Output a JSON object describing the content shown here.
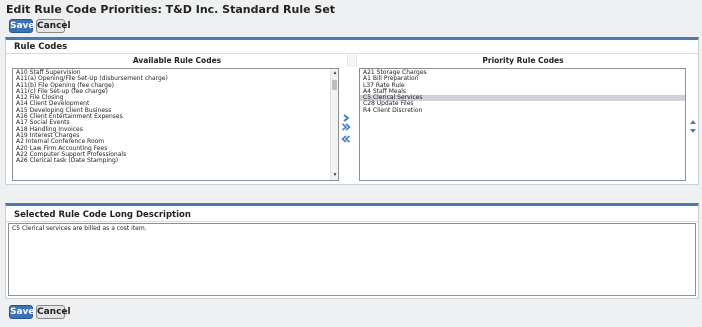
{
  "page_title": "Edit Rule Code Priorities: T&D Inc. Standard Rule Set",
  "top_toolbar": {
    "save_label": "Save",
    "cancel_label": "Cancel"
  },
  "rule_codes": {
    "section_title": "Rule Codes",
    "available_header": "Available Rule Codes",
    "priority_header": "Priority Rule Codes",
    "available_items": [
      "A10 Staff Supervision",
      "A11(a) Opening/File Set-Up (disbursement charge)",
      "A11(b) File Opening (fee charge)",
      "A11(c) File Set-up (fee charge)",
      "A12 File Closing",
      "A14 Client Development",
      "A15 Developing Client Business",
      "A16 Client Entertainment Expenses",
      "A17 Social Events",
      "A18 Handling Invoices",
      "A19 Interest Charges",
      "A2 Internal Conference Room",
      "A20 Law Firm Accounting Fees",
      "A22 Computer Support Professionals",
      "A26 Clerical task (Date Stamping)"
    ],
    "priority_items": [
      "A21 Storage Charges",
      "A1 Bill Preparation",
      "L37 Rate Rule",
      "A4 Staff Meals",
      "C5 Clerical Services",
      "C28 Update Files",
      "R4 Client Discretion"
    ],
    "priority_selected_index": 4
  },
  "long_description": {
    "section_title": "Selected Rule Code Long Description",
    "text": "C5 Clerical services are billed as a cost item."
  },
  "bottom_toolbar": {
    "save_label": "Save",
    "cancel_label": "Cancel"
  },
  "colors": {
    "accent": "#3d72b8",
    "arrow_blue": "#3f7fc8",
    "panel_border_top": "#4a7ab0",
    "selected_row": "#cfd3d8"
  },
  "icons": {
    "add": "chevron-right-icon",
    "add_all": "double-chevron-right-icon",
    "remove_all": "double-chevron-left-icon",
    "move_up": "triangle-up-icon",
    "move_down": "triangle-down-icon"
  }
}
